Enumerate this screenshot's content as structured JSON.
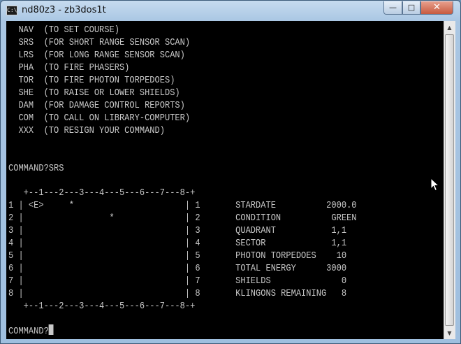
{
  "window": {
    "icon_label": "C:\\",
    "title": "nd80z3 - zb3dos1t",
    "minimize": "—",
    "maximize": "□",
    "close": "✕"
  },
  "help_lines": [
    "  NAV  (TO SET COURSE)",
    "  SRS  (FOR SHORT RANGE SENSOR SCAN)",
    "  LRS  (FOR LONG RANGE SENSOR SCAN)",
    "  PHA  (TO FIRE PHASERS)",
    "  TOR  (TO FIRE PHOTON TORPEDOES)",
    "  SHE  (TO RAISE OR LOWER SHIELDS)",
    "  DAM  (FOR DAMAGE CONTROL REPORTS)",
    "  COM  (TO CALL ON LIBRARY-COMPUTER)",
    "  XXX  (TO RESIGN YOUR COMMAND)"
  ],
  "prompt_entered": "COMMAND?SRS",
  "scan_lines": [
    "   +--1---2---3---4---5---6---7---8-+",
    "1 | <E>     *                      | 1       STARDATE          2000.0",
    "2 |                 *              | 2       CONDITION          GREEN",
    "3 |                                | 3       QUADRANT           1,1",
    "4 |                                | 4       SECTOR             1,1",
    "5 |                                | 5       PHOTON TORPEDOES    10",
    "6 |                                | 6       TOTAL ENERGY      3000",
    "7 |                                | 7       SHIELDS              0",
    "8 |                                | 8       KLINGONS REMAINING   8",
    "   +--1---2---3---4---5---6---7---8-+"
  ],
  "prompt_current": "COMMAND?",
  "scroll_up": "▲",
  "scroll_down": "▼"
}
